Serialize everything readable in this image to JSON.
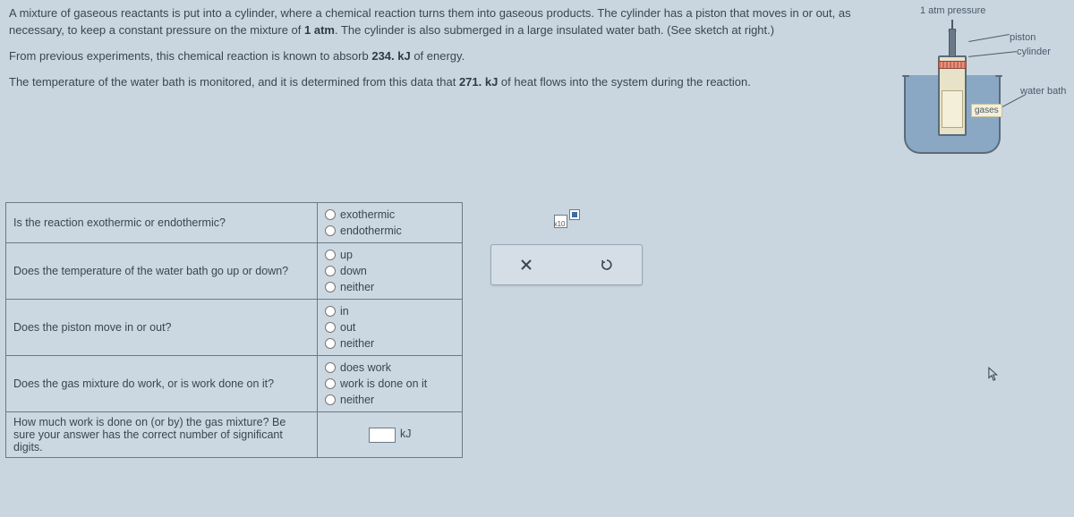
{
  "problem": {
    "p1_a": "A mixture of gaseous reactants is put into a cylinder, where a chemical reaction turns them into gaseous products. The cylinder has a piston that moves in or out, as necessary, to keep a constant pressure on the mixture of ",
    "p1_val": "1 atm",
    "p1_b": ". The cylinder is also submerged in a large insulated water bath. (See sketch at right.)",
    "p2_a": "From previous experiments, this chemical reaction is known to absorb ",
    "p2_val": "234. kJ",
    "p2_b": " of energy.",
    "p3_a": "The temperature of the water bath is monitored, and it is determined from this data that ",
    "p3_val": "271. kJ",
    "p3_b": " of heat flows into the system during the reaction."
  },
  "diagram": {
    "pressure_label": "1 atm pressure",
    "piston_label": "piston",
    "cylinder_label": "cylinder",
    "waterbath_label": "water bath",
    "gases_label": "gases"
  },
  "questions": {
    "q1": {
      "prompt": "Is the reaction exothermic or endothermic?",
      "opts": [
        "exothermic",
        "endothermic"
      ]
    },
    "q2": {
      "prompt": "Does the temperature of the water bath go up or down?",
      "opts": [
        "up",
        "down",
        "neither"
      ]
    },
    "q3": {
      "prompt": "Does the piston move in or out?",
      "opts": [
        "in",
        "out",
        "neither"
      ]
    },
    "q4": {
      "prompt": "Does the gas mixture do work, or is work done on it?",
      "opts": [
        "does work",
        "work is done on it",
        "neither"
      ]
    },
    "q5": {
      "prompt": "How much work is done on (or by) the gas mixture? Be sure your answer has the correct number of significant digits.",
      "unit": "kJ"
    }
  },
  "toolbar": {
    "x10": "x10"
  }
}
